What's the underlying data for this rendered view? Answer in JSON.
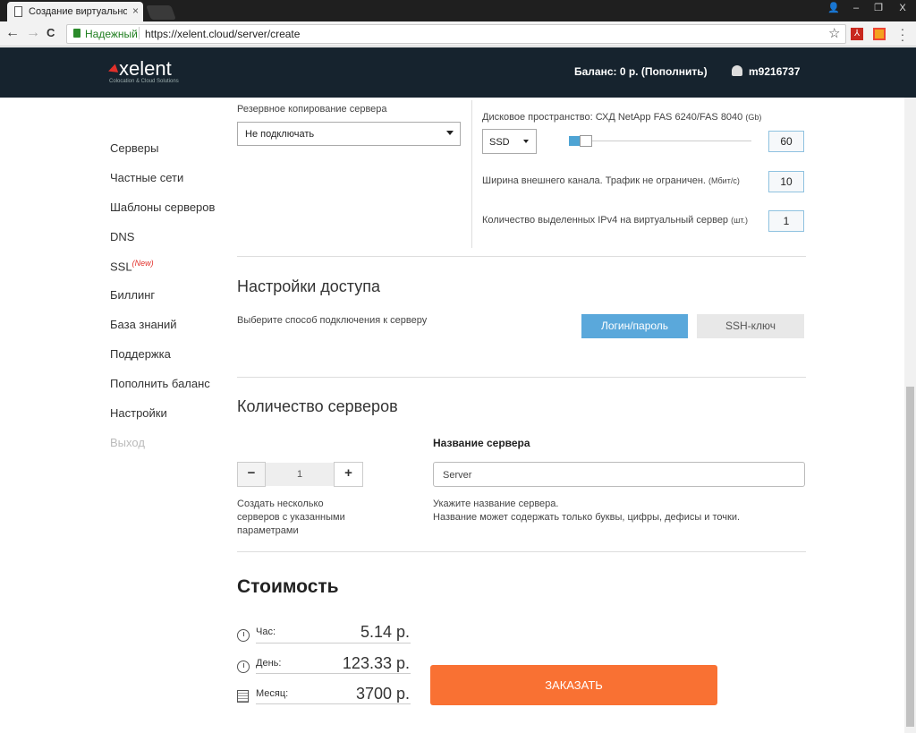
{
  "browser": {
    "tab_title": "Создание виртуального",
    "tab_close": "×",
    "window_controls": [
      "👤",
      "–",
      "❐",
      "X"
    ],
    "secure_label": "Надежный",
    "url": "https://xelent.cloud/server/create",
    "nav": {
      "back": "←",
      "forward": "→",
      "reload": "C"
    },
    "star": "☆",
    "ext_pdf": "⅄"
  },
  "header": {
    "logo": "xelent",
    "logo_mark": "◀",
    "logo_sub": "Colocation & Cloud Solutions",
    "balance": "Баланс: 0 р. (Пополнить)",
    "username": "m9216737"
  },
  "sidebar": {
    "items": [
      {
        "label": "Серверы"
      },
      {
        "label": "Частные сети"
      },
      {
        "label": "Шаблоны серверов"
      },
      {
        "label": "DNS"
      },
      {
        "label": "SSL",
        "badge": "(New)"
      },
      {
        "label": "Биллинг"
      },
      {
        "label": "База знаний"
      },
      {
        "label": "Поддержка"
      },
      {
        "label": "Пополнить баланс"
      },
      {
        "label": "Настройки"
      },
      {
        "label": "Выход"
      }
    ]
  },
  "config": {
    "backup_label": "Резервное копирование сервера",
    "backup_value": "Не подключать",
    "disk_label": "Дисковое пространство: СХД NetApp FAS 6240/FAS 8040",
    "disk_unit": "(Gb)",
    "disk_type": "SSD",
    "disk_value": "60",
    "channel_label": "Ширина внешнего канала. Трафик не ограничен.",
    "channel_unit": "(Мбит/с)",
    "channel_value": "10",
    "ipv4_label": "Количество выделенных IPv4 на виртуальный сервер",
    "ipv4_unit": "(шт.)",
    "ipv4_value": "1"
  },
  "access": {
    "title": "Настройки доступа",
    "description": "Выберите способ подключения к серверу",
    "login_button": "Логин/пароль",
    "ssh_button": "SSH-ключ"
  },
  "servers": {
    "title": "Количество серверов",
    "minus": "−",
    "plus": "+",
    "count": "1",
    "count_hint_1": "Создать несколько",
    "count_hint_2": "серверов с указанными",
    "count_hint_3": "параметрами",
    "name_label": "Название сервера",
    "name_value": "Server",
    "name_hint_1": "Укажите название сервера.",
    "name_hint_2": "Название может содержать только буквы, цифры, дефисы и точки."
  },
  "cost": {
    "title": "Стоимость",
    "hour_label": "Час:",
    "hour_value": "5.14 р.",
    "day_label": "День:",
    "day_value": "123.33 р.",
    "month_label": "Месяц:",
    "month_value": "3700 р.",
    "order_button": "ЗАКАЗАТЬ"
  },
  "colors": {
    "header_bg": "#16232e",
    "accent_blue": "#5aa8db",
    "order_orange": "#f97133",
    "brand_red": "#e2302a"
  }
}
